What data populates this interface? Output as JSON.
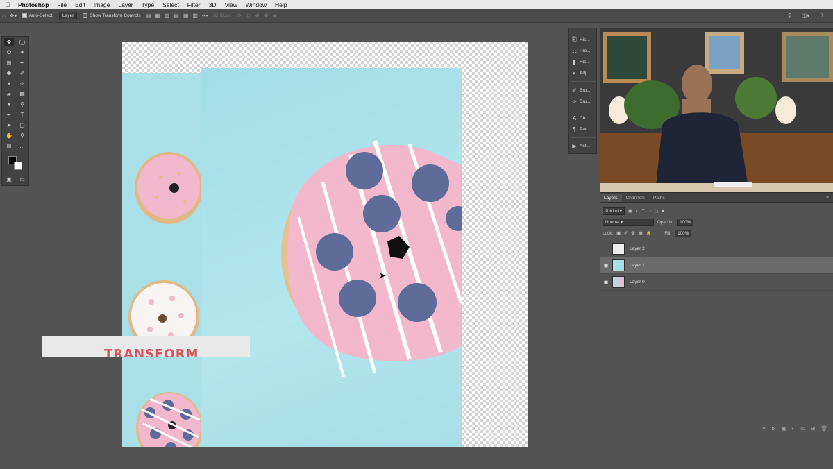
{
  "menubar": {
    "app": "Photoshop",
    "items": [
      "File",
      "Edit",
      "Image",
      "Layer",
      "Type",
      "Select",
      "Filter",
      "3D",
      "View",
      "Window",
      "Help"
    ]
  },
  "options": {
    "auto_select_label": "Auto-Select:",
    "auto_select_value": "Layer",
    "transform_label": "Show Transform Controls",
    "mode_3d": "3D Mode:"
  },
  "canvas": {
    "banner_text": "TRANSFORM"
  },
  "dock": {
    "items": [
      {
        "label": "His...",
        "icon": "history-icon"
      },
      {
        "label": "Pro...",
        "icon": "properties-icon"
      },
      {
        "label": "His...",
        "icon": "histogram-icon"
      },
      {
        "label": "Adj...",
        "icon": "adjustments-icon"
      },
      {
        "label": "Bru...",
        "icon": "brush-icon"
      },
      {
        "label": "Bru...",
        "icon": "brush-settings-icon"
      },
      {
        "label": "Ch...",
        "icon": "character-icon"
      },
      {
        "label": "Par...",
        "icon": "paragraph-icon"
      },
      {
        "label": "Act...",
        "icon": "actions-icon"
      }
    ]
  },
  "layers_panel": {
    "tabs": [
      "Layers",
      "Channels",
      "Paths"
    ],
    "filter": "Kind",
    "blend_mode": "Normal",
    "opacity_label": "Opacity:",
    "opacity_value": "100%",
    "lock_label": "Lock:",
    "fill_label": "Fill:",
    "fill_value": "100%",
    "layers": [
      {
        "name": "Layer 2",
        "visible": false,
        "selected": false
      },
      {
        "name": "Layer 1",
        "visible": true,
        "selected": true
      },
      {
        "name": "Layer 0",
        "visible": true,
        "selected": false
      }
    ]
  },
  "colors": {
    "canvas_cyan": "#a9e0e8",
    "banner_text": "#d6555f",
    "workspace": "#535353"
  }
}
